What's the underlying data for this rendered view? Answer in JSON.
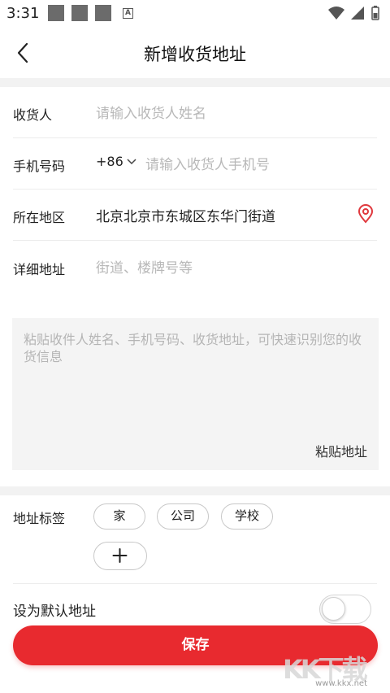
{
  "status_bar": {
    "time": "3:31",
    "notif_icon_letter": "A"
  },
  "nav": {
    "title": "新增收货地址"
  },
  "form": {
    "name": {
      "label": "收货人",
      "placeholder": "请输入收货人姓名"
    },
    "phone": {
      "label": "手机号码",
      "country_code": "+86",
      "placeholder": "请输入收货人手机号"
    },
    "region": {
      "label": "所在地区",
      "value": "北京北京市东城区东华门街道"
    },
    "detail": {
      "label": "详细地址",
      "placeholder": "街道、楼牌号等"
    }
  },
  "paste": {
    "placeholder": "粘贴收件人姓名、手机号码、收货地址，可快速识别您的收货信息",
    "button_label": "粘贴地址"
  },
  "tags": {
    "label": "地址标签",
    "items": [
      "家",
      "公司",
      "学校"
    ],
    "add_symbol": "+"
  },
  "default": {
    "label": "设为默认地址",
    "enabled": false
  },
  "save_label": "保存",
  "watermark": {
    "text": "KK下载",
    "url": "www.kkx.net"
  },
  "colors": {
    "accent": "#e82a2f",
    "location_icon": "#e0393e"
  }
}
